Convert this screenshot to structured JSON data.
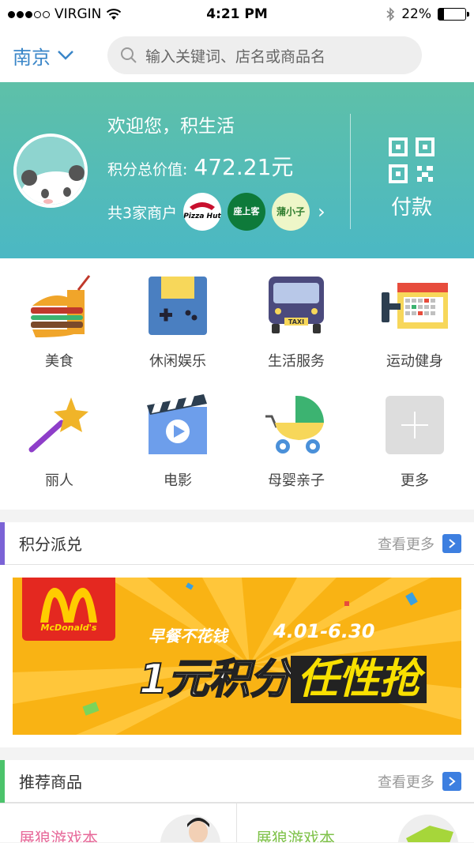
{
  "status_bar": {
    "carrier": "VIRGIN",
    "time": "4:21 PM",
    "battery": "22%",
    "battery_level": 0.22,
    "signal_dots_filled": 3,
    "signal_dots_total": 5
  },
  "header": {
    "city": "南京",
    "search_placeholder": "输入关键词、店名或商品名"
  },
  "account": {
    "welcome": "欢迎您，积生活",
    "points_label": "积分总价值:",
    "points_value": "472.21元",
    "merchants_label": "共3家商户",
    "merchant_logos": [
      "Pizza Hut",
      "座上客",
      "蒲小子"
    ],
    "pay_label": "付款"
  },
  "categories": [
    {
      "label": "美食",
      "icon": "food-icon"
    },
    {
      "label": "休闲娱乐",
      "icon": "gamepad-icon"
    },
    {
      "label": "生活服务",
      "icon": "taxi-icon"
    },
    {
      "label": "运动健身",
      "icon": "fitness-calendar-icon"
    },
    {
      "label": "丽人",
      "icon": "magic-wand-icon"
    },
    {
      "label": "电影",
      "icon": "movie-clapper-icon"
    },
    {
      "label": "母婴亲子",
      "icon": "stroller-icon"
    },
    {
      "label": "更多",
      "icon": "plus-icon"
    }
  ],
  "points_section": {
    "title": "积分派兑",
    "more": "查看更多",
    "accent": "#7b63d6"
  },
  "promo": {
    "brand": "McDonald's",
    "tagline": "早餐不花钱",
    "dates": "4.01-6.30",
    "headline_a": "1元积分",
    "headline_b": "任性抢"
  },
  "recommend_section": {
    "title": "推荐商品",
    "more": "查看更多",
    "accent": "#4cc36b"
  },
  "products": [
    {
      "name": "展狼游戏本",
      "color": "#e76a9a"
    },
    {
      "name": "展狼游戏本",
      "color": "#7fc24a"
    }
  ],
  "colors": {
    "city_blue": "#3a86c8",
    "more_button": "#3d7fe0"
  }
}
